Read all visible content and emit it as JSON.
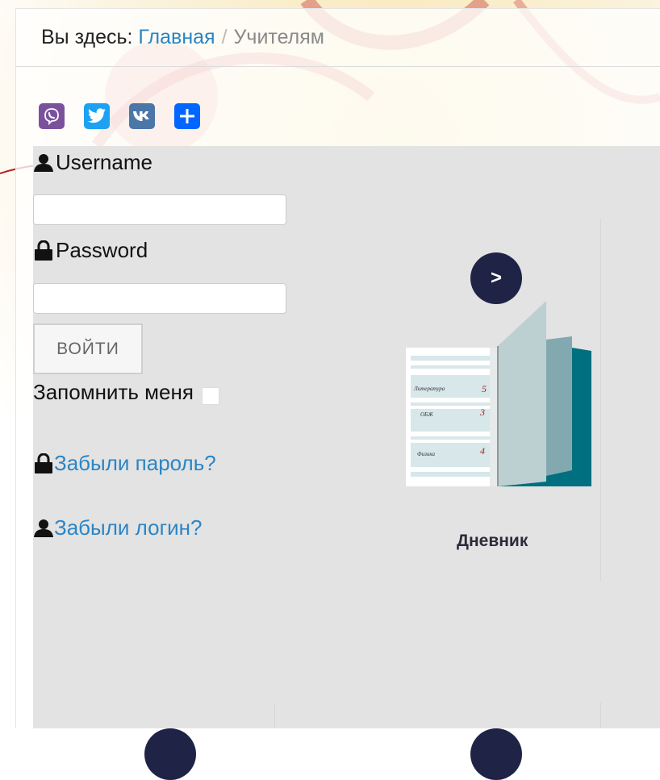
{
  "breadcrumb": {
    "prefix": "Вы здесь:",
    "home": "Главная",
    "separator": "/",
    "current": "Учителям"
  },
  "share": [
    {
      "name": "viber-icon",
      "color": "#7b519d"
    },
    {
      "name": "twitter-icon",
      "color": "#1da1f2"
    },
    {
      "name": "vk-icon",
      "color": "#4a76a8"
    },
    {
      "name": "share-plus-icon",
      "color": "#0166ff"
    }
  ],
  "login": {
    "username_label": "Username",
    "username_value": "",
    "password_label": "Password",
    "password_value": "",
    "submit_label": "ВОЙТИ",
    "remember_label": "Запомнить меня",
    "forgot_password": "Забыли пароль?",
    "forgot_login": "Забыли логин?"
  },
  "tiles": [
    {
      "arrow": ">",
      "title": "Дневник",
      "icon": "diary-icon"
    }
  ],
  "diary_image": {
    "rows": [
      {
        "subject": "Литература",
        "grade": "5"
      },
      {
        "subject": "ОБЖ",
        "grade": "3"
      },
      {
        "subject": "Физика",
        "grade": "4"
      }
    ]
  },
  "colors": {
    "link": "#2a85c5",
    "panel": "#e3e3e3",
    "arrow_circle": "#1f2446",
    "diary_teal": "#006f80"
  }
}
